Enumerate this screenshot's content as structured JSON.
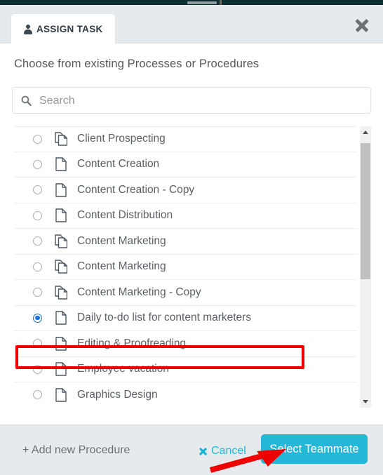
{
  "topbar": {
    "present": true,
    "background": "#0b2e33"
  },
  "header": {
    "tab_label": "ASSIGN TASK",
    "tab_icon": "person-icon",
    "close_icon": "close-icon"
  },
  "body": {
    "subtitle": "Choose from existing Processes or Procedures",
    "search": {
      "placeholder": "Search",
      "value": "",
      "icon": "search-icon"
    }
  },
  "list": {
    "items": [
      {
        "label": "Client Prospecting",
        "icon": "copy-pages-icon",
        "selected": false
      },
      {
        "label": "Content Creation",
        "icon": "single-page-icon",
        "selected": false
      },
      {
        "label": "Content Creation - Copy",
        "icon": "single-page-icon",
        "selected": false
      },
      {
        "label": "Content Distribution",
        "icon": "single-page-icon",
        "selected": false
      },
      {
        "label": "Content Marketing",
        "icon": "copy-pages-icon",
        "selected": false
      },
      {
        "label": "Content Marketing",
        "icon": "copy-pages-icon",
        "selected": false
      },
      {
        "label": "Content Marketing - Copy",
        "icon": "copy-pages-icon",
        "selected": false
      },
      {
        "label": "Daily to-do list for content marketers",
        "icon": "single-page-icon",
        "selected": true
      },
      {
        "label": "Editing & Proofreading",
        "icon": "single-page-icon",
        "selected": false
      },
      {
        "label": "Employee vacation",
        "icon": "single-page-icon",
        "selected": false
      },
      {
        "label": "Graphics Design",
        "icon": "single-page-icon",
        "selected": false
      }
    ],
    "scrollbar": {
      "up_arrow_icon": "scroll-up-arrow-icon",
      "down_arrow_icon": "scroll-down-arrow-icon",
      "thumb_position_percent": 6,
      "thumb_size_percent": 50
    }
  },
  "footer": {
    "add_label": "+ Add new Procedure",
    "cancel_label": "Cancel",
    "cancel_icon": "close-icon",
    "primary_label": "Select Teammate",
    "primary_color": "#23b8d5",
    "cancel_color": "#1cb8d8"
  },
  "annotations": {
    "highlight_box_color": "#ef0000",
    "highlight_target": "Daily to-do list for content marketers",
    "arrow_color": "#ef0000",
    "arrow_target": "Select Teammate"
  }
}
